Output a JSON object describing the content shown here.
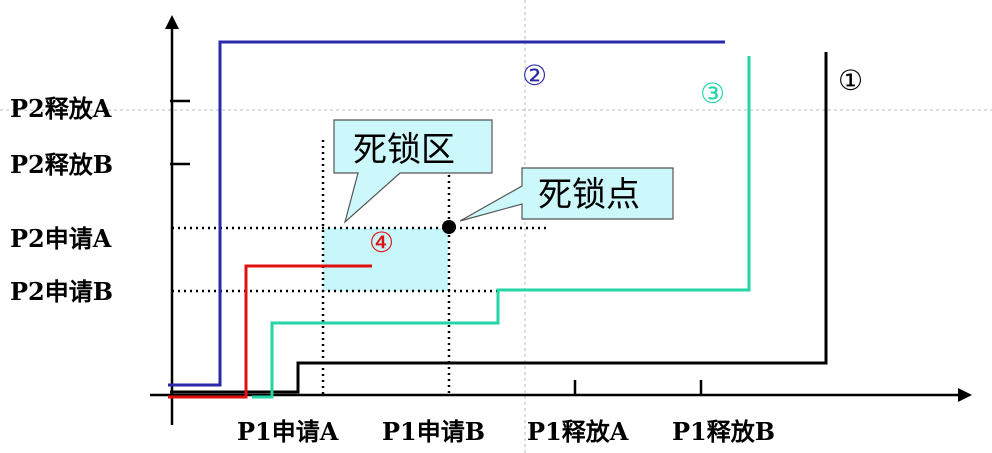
{
  "diagram": {
    "x_labels": [
      "P1申请A",
      "P1申请B",
      "P1释放A",
      "P1释放B"
    ],
    "y_labels": [
      "P2释放A",
      "P2释放B",
      "P2申请A",
      "P2申请B"
    ],
    "path_labels": {
      "one": "①",
      "two": "②",
      "three": "③",
      "four": "④"
    },
    "callouts": {
      "deadlock_region": "死锁区",
      "deadlock_point": "死锁点"
    },
    "colors": {
      "path1": "#000000",
      "path2": "#2a2aa8",
      "path3": "#22d6a6",
      "path4": "#e01010",
      "region_fill": "#c8f7fb",
      "callout_fill": "#ccf8fb"
    }
  }
}
